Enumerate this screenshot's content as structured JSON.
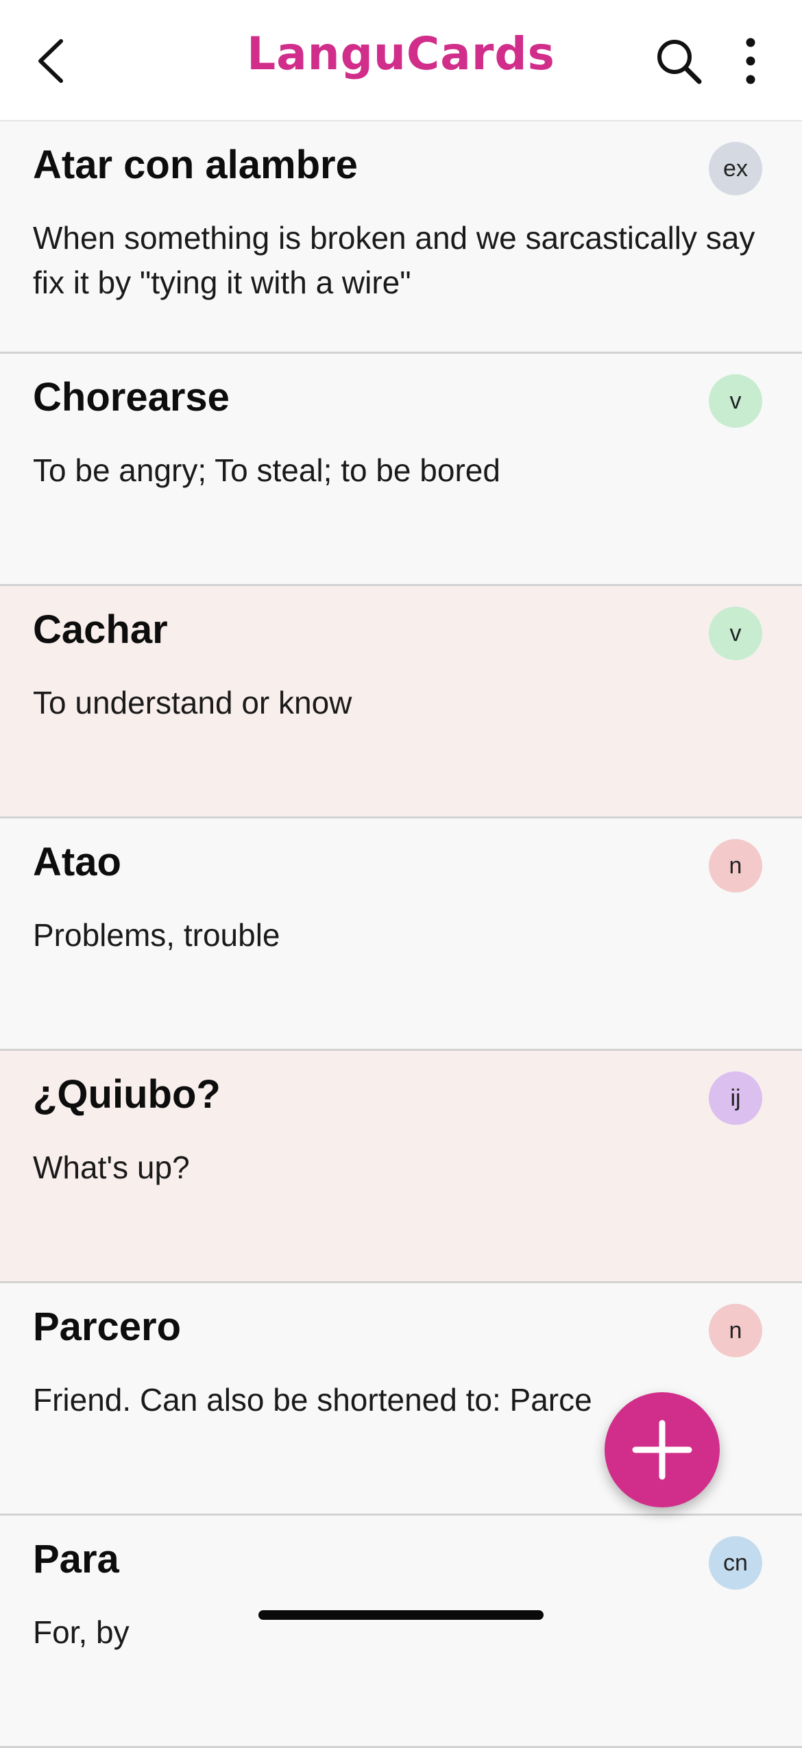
{
  "header": {
    "title": "LanguCards",
    "back_icon": "chevron-left-icon",
    "search_icon": "search-icon",
    "more_icon": "more-vertical-icon"
  },
  "colors": {
    "accent": "#d12d8a",
    "highlight_row": "#f8eeec",
    "badge_ex": "#d5d9e1",
    "badge_v": "#c7ecd0",
    "badge_n": "#f3c9c9",
    "badge_ij": "#dbbfee",
    "badge_cn": "#c3dbee"
  },
  "cards": [
    {
      "term": "Atar con alambre",
      "definition": "When something is broken and we sarcastically say fix it by \"tying it with a wire\"",
      "badge": "ex",
      "highlighted": false
    },
    {
      "term": "Chorearse",
      "definition": "To be angry; To steal; to be bored",
      "badge": "v",
      "highlighted": false
    },
    {
      "term": "Cachar",
      "definition": "To understand or know",
      "badge": "v",
      "highlighted": true
    },
    {
      "term": "Atao",
      "definition": "Problems, trouble",
      "badge": "n",
      "highlighted": false
    },
    {
      "term": "¿Quiubo?",
      "definition": "What's up?",
      "badge": "ij",
      "highlighted": true
    },
    {
      "term": "Parcero",
      "definition": "Friend. Can also be shortened to: Parce",
      "badge": "n",
      "highlighted": false
    },
    {
      "term": "Para",
      "definition": "For, by",
      "badge": "cn",
      "highlighted": false
    }
  ],
  "fab": {
    "icon": "plus-icon"
  }
}
